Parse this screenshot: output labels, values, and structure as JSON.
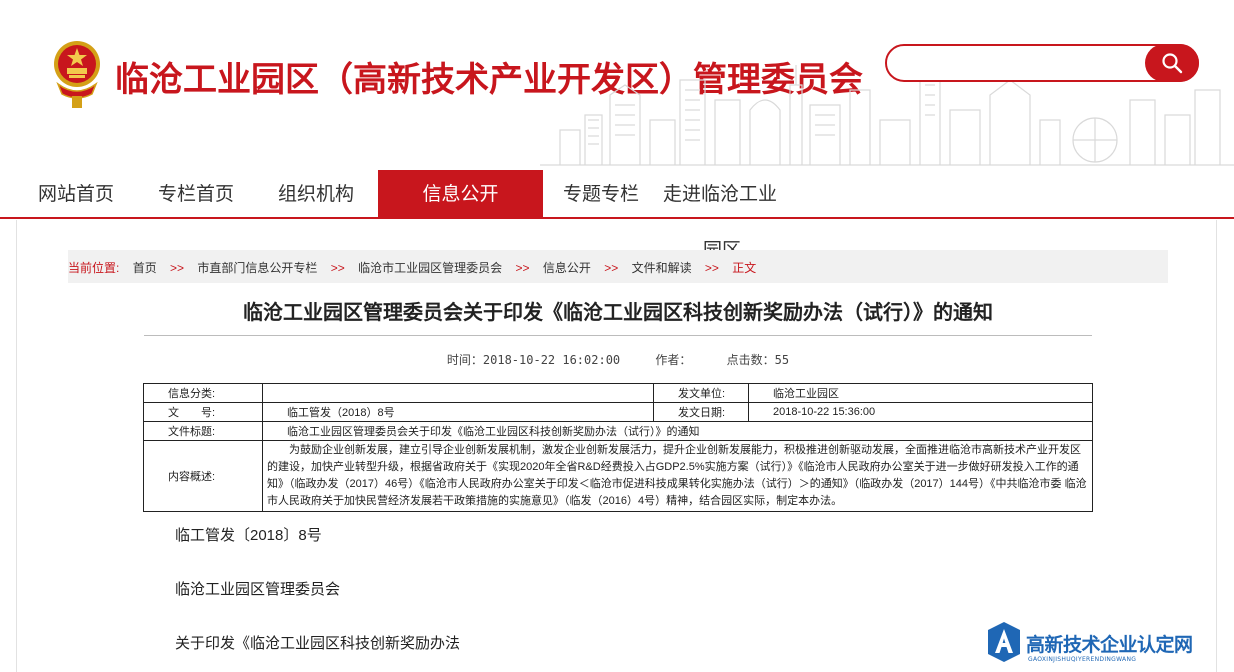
{
  "header": {
    "site_title": "临沧工业园区（高新技术产业开发区）管理委员会",
    "search": {
      "placeholder": "",
      "value": ""
    }
  },
  "nav": {
    "items": [
      {
        "label": "网站首页",
        "active": false
      },
      {
        "label": "专栏首页",
        "active": false
      },
      {
        "label": "组织机构",
        "active": false
      },
      {
        "label": "信息公开",
        "active": true
      },
      {
        "label": "专题专栏",
        "active": false
      },
      {
        "label": "走进临沧工业",
        "active": false
      }
    ],
    "overflow_label": "园区"
  },
  "breadcrumb": {
    "label": "当前位置:",
    "separator": ">>",
    "items": [
      "首页",
      "市直部门信息公开专栏",
      "临沧市工业园区管理委员会",
      "信息公开",
      "文件和解读",
      "正文"
    ]
  },
  "article": {
    "title": "临沧工业园区管理委员会关于印发《临沧工业园区科技创新奖励办法（试行）》的通知",
    "meta": {
      "time": "时间：2018-10-22 16:02:00",
      "author": "作者：",
      "clicks": "点击数：55"
    },
    "info": {
      "category_label": "信息分类:",
      "category_value": "",
      "issuer_label": "发文单位:",
      "issuer_value": "临沧工业园区",
      "doc_no_label": "文　　号:",
      "doc_no_value": "临工管发（2018）8号",
      "date_label": "发文日期:",
      "date_value": "2018-10-22 15:36:00",
      "file_title_label": "文件标题:",
      "file_title_value": "临沧工业园区管理委员会关于印发《临沧工业园区科技创新奖励办法（试行）》的通知",
      "summary_label": "内容概述:",
      "summary_value": "为鼓励企业创新发展，建立引导企业创新发展机制，激发企业创新发展活力，提升企业创新发展能力，积极推进创新驱动发展，全面推进临沧市高新技术产业开发区的建设，加快产业转型升级，根据省政府关于《实现2020年全省R&D经费投入占GDP2.5%实施方案（试行）》《临沧市人民政府办公室关于进一步做好研发投入工作的通知》（临政办发（2017）46号）《临沧市人民政府办公室关于印发＜临沧市促进科技成果转化实施办法（试行）＞的通知》（临政办发（2017）144号）《中共临沧市委 临沧市人民政府关于加快民营经济发展若干政策措施的实施意见》（临发（2016）4号）精神，结合园区实际，制定本办法。"
    },
    "body": [
      "临工管发〔2018〕8号",
      "临沧工业园区管理委员会",
      "关于印发《临沧工业园区科技创新奖励办法"
    ]
  },
  "watermark": {
    "text": "高新技术企业认定网",
    "subtext": "GAOXINJISHUQIYERENDINGWANG"
  },
  "colors": {
    "brand_red": "#c8161d",
    "watermark_blue": "#1f67b5",
    "breadcrumb_bg": "#f1f1f1"
  }
}
